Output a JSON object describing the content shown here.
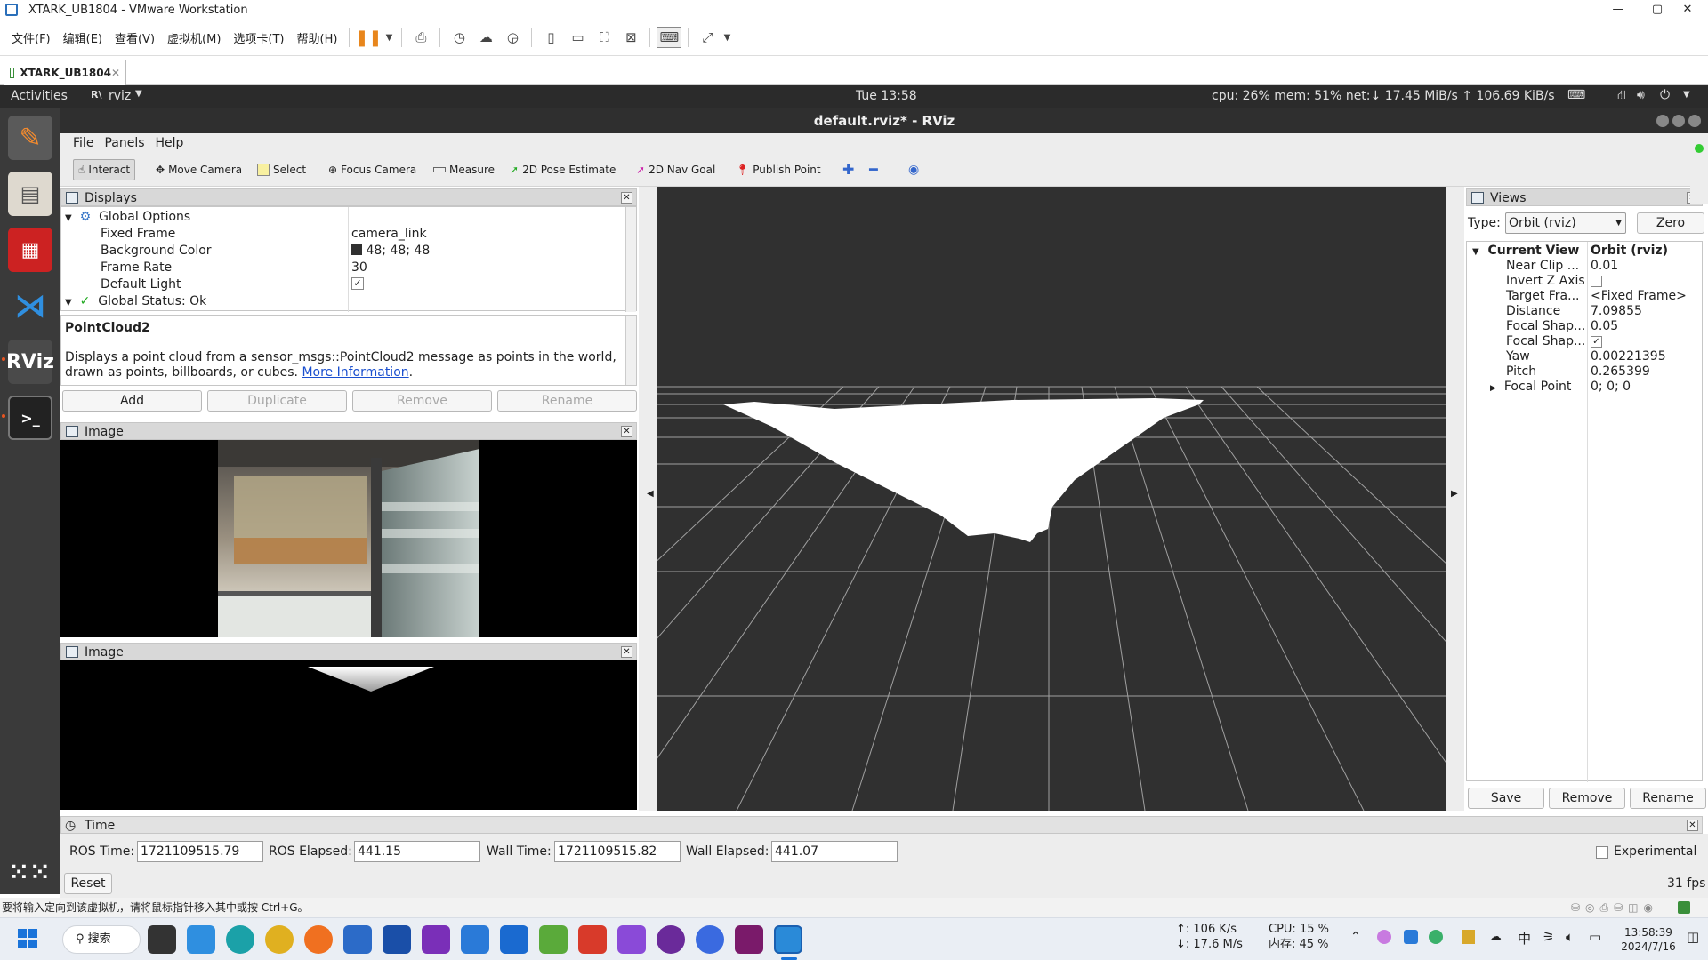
{
  "vmware": {
    "title": "XTARK_UB1804 - VMware Workstation",
    "menus": [
      "文件(F)",
      "编辑(E)",
      "查看(V)",
      "虚拟机(M)",
      "选项卡(T)",
      "帮助(H)"
    ],
    "tab_label": "XTARK_UB1804",
    "status_hint": "要将输入定向到该虚拟机，请将鼠标指针移入其中或按 Ctrl+G。"
  },
  "ubuntu_bar": {
    "activities": "Activities",
    "app": "rviz",
    "clock": "Tue 13:58",
    "sysmon": "cpu: 26% mem: 51% net:↓ 17.45 MiB/s ↑ 106.69 KiB/s"
  },
  "rviz": {
    "title": "default.rviz* - RViz",
    "menu": [
      "File",
      "Panels",
      "Help"
    ],
    "tools": [
      "Interact",
      "Move Camera",
      "Select",
      "Focus Camera",
      "Measure",
      "2D Pose Estimate",
      "2D Nav Goal",
      "Publish Point"
    ],
    "displays": {
      "header": "Displays",
      "global_options": "Global Options",
      "rows": [
        {
          "name": "Fixed Frame",
          "value": "camera_link"
        },
        {
          "name": "Background Color",
          "value": "48; 48; 48"
        },
        {
          "name": "Frame Rate",
          "value": "30"
        },
        {
          "name": "Default Light",
          "value": "✓"
        }
      ],
      "global_status": "Global Status: Ok",
      "desc_title": "PointCloud2",
      "desc_text": "Displays a point cloud from a sensor_msgs::PointCloud2 message as points in the world, drawn as points, billboards, or cubes.",
      "desc_link": "More Information",
      "desc_end": ".",
      "buttons": [
        "Add",
        "Duplicate",
        "Remove",
        "Rename"
      ]
    },
    "image1_header": "Image",
    "image2_header": "Image",
    "views": {
      "header": "Views",
      "type_label": "Type:",
      "type_value": "Orbit (rviz)",
      "zero": "Zero",
      "current_view": "Current View",
      "current_type": "Orbit (rviz)",
      "rows": [
        {
          "name": "Near Clip ...",
          "value": "0.01"
        },
        {
          "name": "Invert Z Axis",
          "value": ""
        },
        {
          "name": "Target Fra...",
          "value": "<Fixed Frame>"
        },
        {
          "name": "Distance",
          "value": "7.09855"
        },
        {
          "name": "Focal Shap...",
          "value": "0.05"
        },
        {
          "name": "Focal Shap...",
          "value": "✓"
        },
        {
          "name": "Yaw",
          "value": "0.00221395"
        },
        {
          "name": "Pitch",
          "value": "0.265399"
        },
        {
          "name": "Focal Point",
          "value": "0; 0; 0"
        }
      ],
      "buttons": [
        "Save",
        "Remove",
        "Rename"
      ]
    },
    "time": {
      "header": "Time",
      "ros_time_label": "ROS Time:",
      "ros_time": "1721109515.79",
      "ros_elapsed_label": "ROS Elapsed:",
      "ros_elapsed": "441.15",
      "wall_time_label": "Wall Time:",
      "wall_time": "1721109515.82",
      "wall_elapsed_label": "Wall Elapsed:",
      "wall_elapsed": "441.07",
      "experimental": "Experimental",
      "reset": "Reset",
      "fps": "31 fps"
    }
  },
  "taskbar": {
    "search": "搜索",
    "net_up": "↑: 106 K/s",
    "net_down": "↓: 17.6 M/s",
    "cpu": "CPU: 15 %",
    "mem": "内存: 45 %",
    "ime": "中",
    "time": "13:58:39",
    "date": "2024/7/16"
  }
}
